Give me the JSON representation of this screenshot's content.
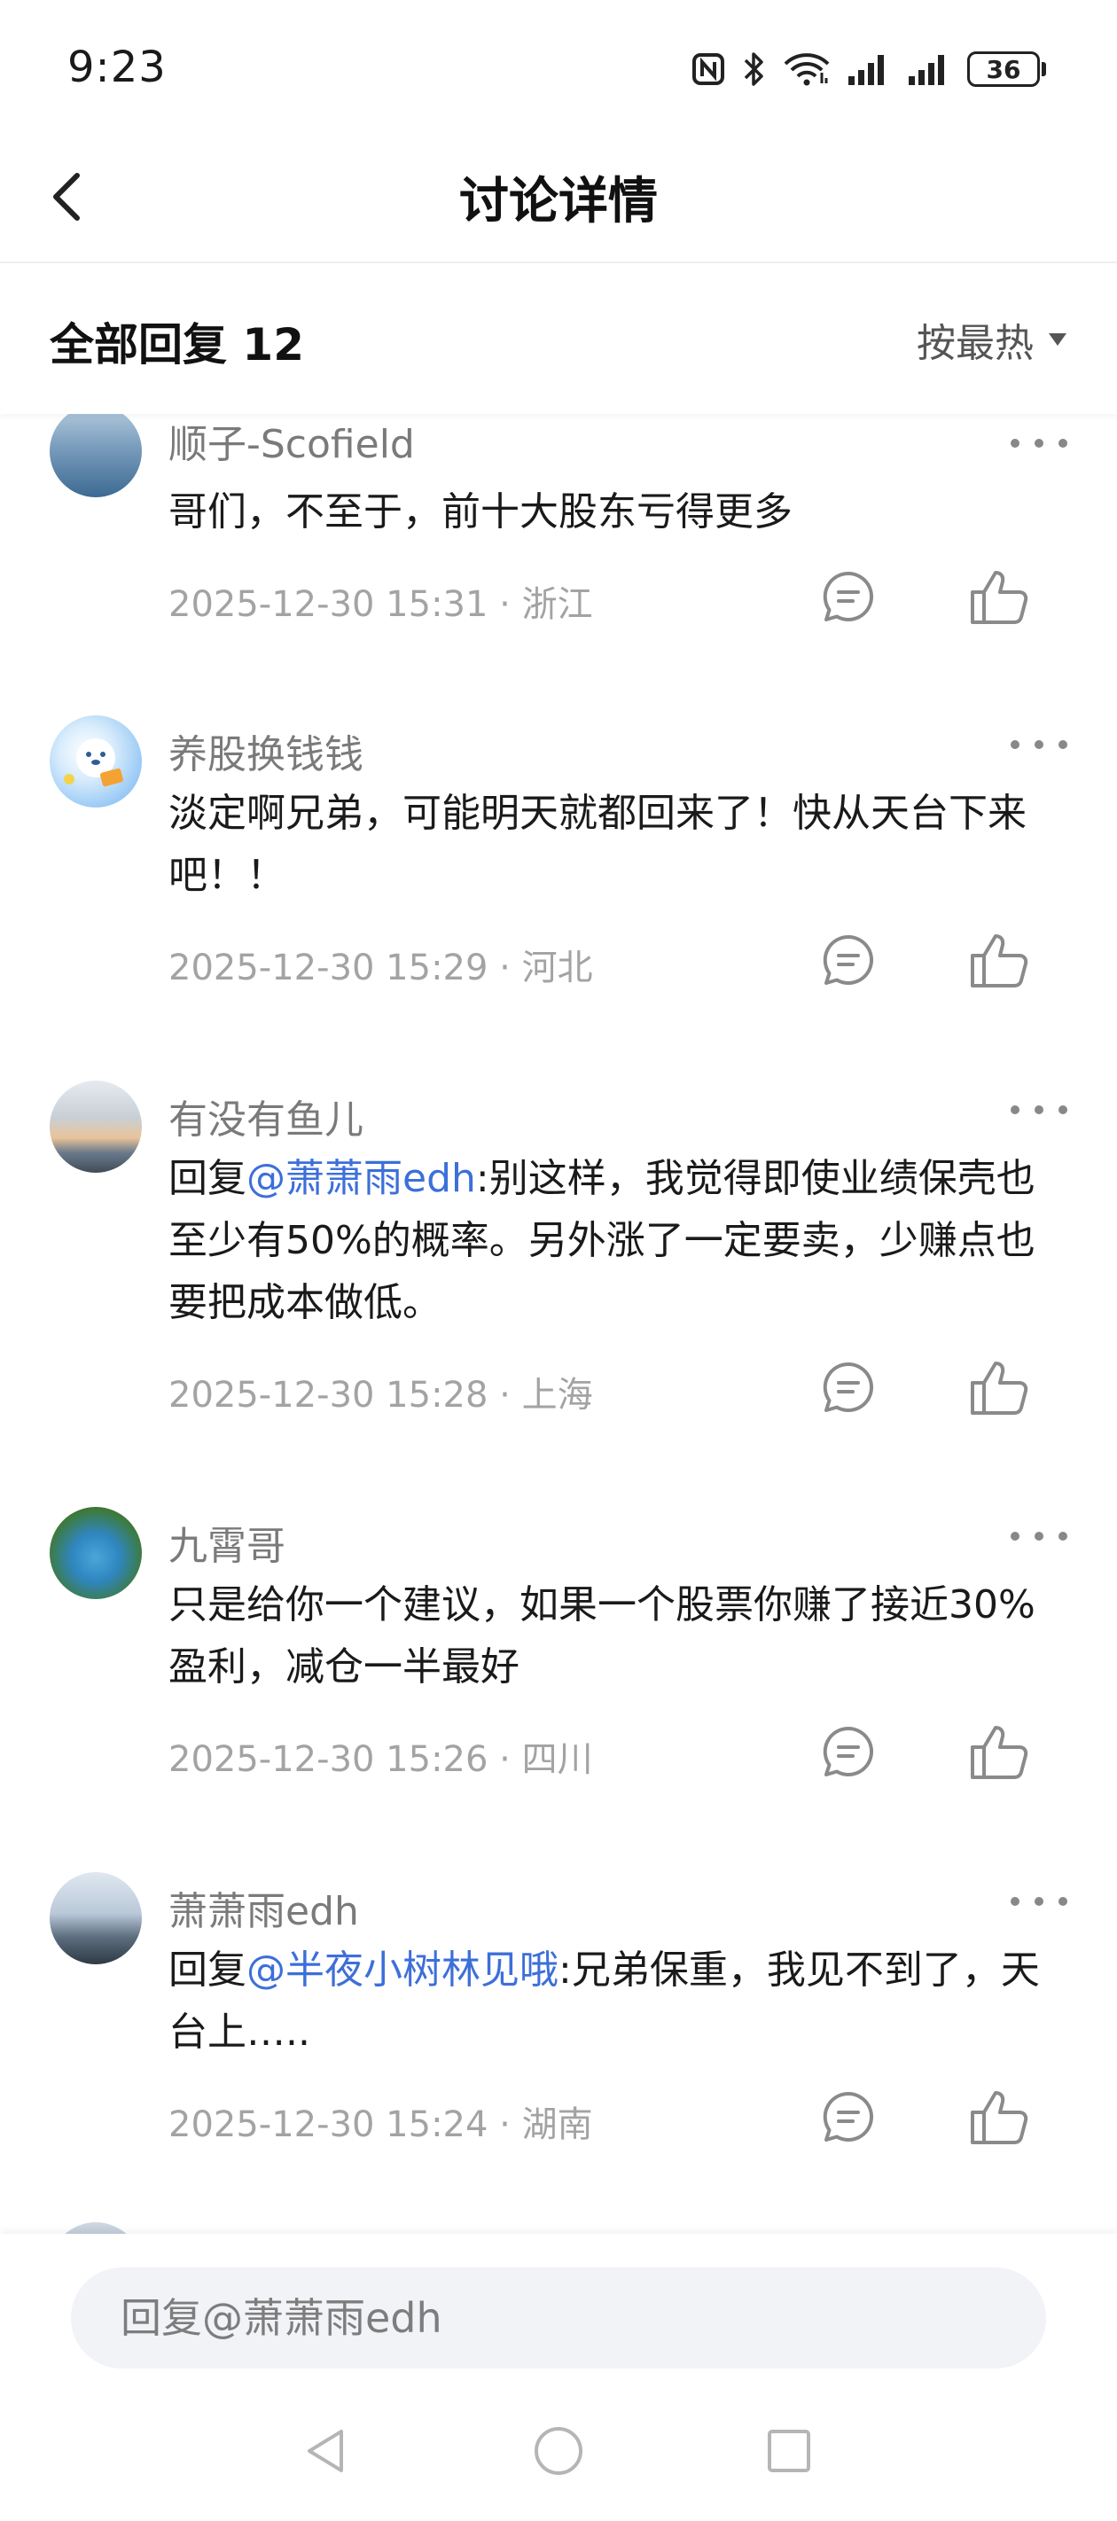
{
  "status_bar": {
    "time": "9:23",
    "battery": "36",
    "icons": [
      "nfc-icon",
      "bluetooth-icon",
      "wifi-icon",
      "signal-icon",
      "signal-icon",
      "battery-icon"
    ]
  },
  "nav": {
    "title": "讨论详情",
    "back_icon": "chevron-left-icon"
  },
  "replies_header": {
    "count_label": "全部回复 12",
    "sort_label": "按最热"
  },
  "comments": [
    {
      "username": "顺子-Scofield",
      "text": "哥们，不至于，前十大股东亏得更多",
      "time": "2025-12-30 15:31",
      "location": "浙江",
      "avatar_colors": [
        "#8fb3d4",
        "#3d6a92"
      ]
    },
    {
      "username": "养股换钱钱",
      "text": "淡定啊兄弟，可能明天就都回来了！快从天台下来吧！！",
      "time": "2025-12-30 15:29",
      "location": "河北",
      "avatar_colors": [
        "#cfe6fb",
        "#6ab0f0"
      ]
    },
    {
      "username": "有没有鱼儿",
      "reply_prefix": "回复",
      "mention": "@萧萧雨edh",
      "text": ":别这样，我觉得即使业绩保壳也至少有50%的概率。另外涨了一定要卖，少赚点也要把成本做低。",
      "time": "2025-12-30 15:28",
      "location": "上海",
      "avatar_colors": [
        "#e9d6b8",
        "#6b7b8c"
      ]
    },
    {
      "username": "九霄哥",
      "text": "只是给你一个建议，如果一个股票你赚了接近30%盈利，减仓一半最好",
      "time": "2025-12-30 15:26",
      "location": "四川",
      "avatar_colors": [
        "#4aa6d8",
        "#3e7a3a"
      ]
    },
    {
      "username": "萧萧雨edh",
      "reply_prefix": "回复",
      "mention": "@半夜小树林见哦",
      "text": ":兄弟保重，我见不到了，天台上…..",
      "time": "2025-12-30 15:24",
      "location": "湖南",
      "avatar_colors": [
        "#c9d7e6",
        "#5e6f80"
      ]
    }
  ],
  "meta_separator": "·",
  "reply_bar": {
    "placeholder": "回复@萧萧雨edh"
  },
  "system_nav": {
    "icons": [
      "back-triangle-icon",
      "home-circle-icon",
      "recents-square-icon"
    ]
  },
  "colors": {
    "mention": "#3d6fd9",
    "meta": "#a3a3a3",
    "username": "#7a7a7a",
    "input_bg": "#f2f3f7"
  }
}
